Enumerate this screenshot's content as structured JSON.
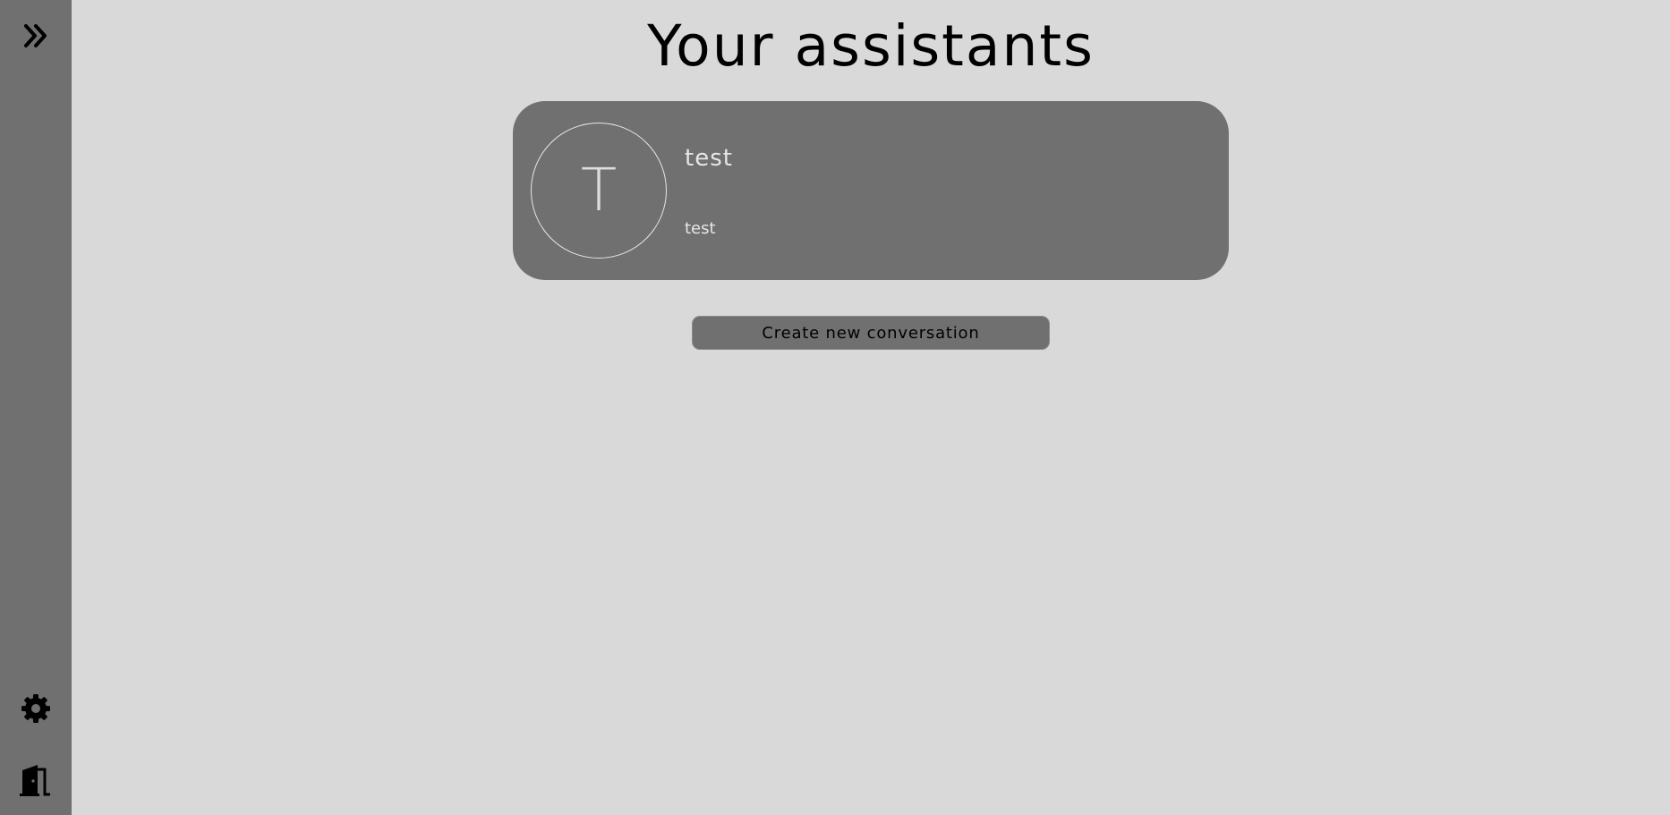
{
  "sidebar": {
    "icons": {
      "expand": "chevrons-right-icon",
      "settings": "gear-icon",
      "logout": "door-exit-icon"
    }
  },
  "main": {
    "title": "Your assistants",
    "assistants": [
      {
        "initial": "T",
        "name": "test",
        "description": "test"
      }
    ],
    "create_button_label": "Create new conversation"
  },
  "colors": {
    "background": "#d9d9d9",
    "sidebar": "#707070",
    "card": "#707070",
    "card_text": "#e6e6e6",
    "icon": "#000000"
  }
}
